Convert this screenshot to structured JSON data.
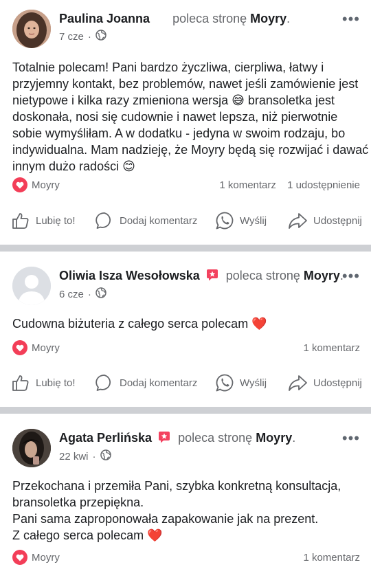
{
  "posts": [
    {
      "author": "Paulina Joanna",
      "recommends": "poleca stronę",
      "page": "Moyry",
      "time": "7 cze",
      "text_lines": [
        "Totalnie polecam! Pani bardzo życzliwa, cierpliwa, łatwy i",
        "przyjemny kontakt, bez problemów, nawet jeśli zamówienie jest",
        "nietypowe i kilka razy zmieniona wersja 😅 bransoletka jest",
        "doskonała, nosi się cudownie  i nawet lepsza, niż pierwotnie",
        "sobie wymyśliłam. A w dodatku - jedyna w swoim rodzaju, bo",
        "indywidualna. Mam nadzieję, że Moyry będą się rozwijać i dawać",
        "innym dużo radości 😊"
      ],
      "reaction_label": "Moyry",
      "comments": "1 komentarz",
      "shares": "1 udostępnienie"
    },
    {
      "author": "Oliwia Isza Wesołowska",
      "recommends": "poleca stronę",
      "page": "Moyry",
      "time": "6 cze",
      "text_lines": [
        "Cudowna biżuteria z całego serca polecam ❤️"
      ],
      "reaction_label": "Moyry",
      "comments": "1 komentarz",
      "shares": ""
    },
    {
      "author": "Agata Perlińska",
      "recommends": "poleca stronę",
      "page": "Moyry",
      "time": "22 kwi",
      "text_lines": [
        "Przekochana i przemiła Pani, szybka konkretną konsultacja,",
        "bransoletka przepiękna.",
        "Pani sama zaproponowała zapakowanie jak na prezent.",
        "Z całego serca polecam ❤️"
      ],
      "reaction_label": "Moyry",
      "comments": "1 komentarz",
      "shares": ""
    }
  ],
  "actions": {
    "like": "Lubię to!",
    "comment": "Dodaj komentarz",
    "send": "Wyślij",
    "share": "Udostępnij"
  },
  "dot": "·",
  "more": "•••",
  "colors": {
    "heart": "#f33e58",
    "separator": "#ced0d4",
    "secondary_text": "#65676b"
  },
  "icons": [
    "globe-icon",
    "more-icon",
    "heart-icon",
    "like-icon",
    "comment-icon",
    "whatsapp-icon",
    "share-icon",
    "recommend-badge-icon"
  ]
}
